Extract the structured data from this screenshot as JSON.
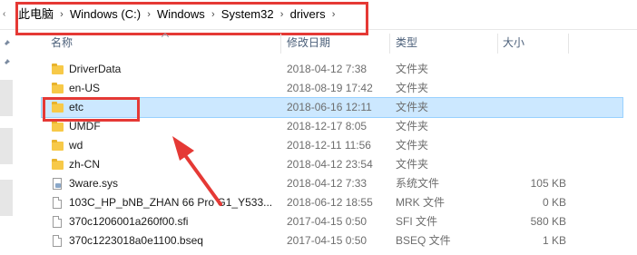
{
  "breadcrumb": {
    "items": [
      "此电脑",
      "Windows (C:)",
      "Windows",
      "System32",
      "drivers"
    ]
  },
  "columns": {
    "name": "名称",
    "date": "修改日期",
    "type": "类型",
    "size": "大小"
  },
  "files": [
    {
      "name": "DriverData",
      "date": "2018-04-12 7:38",
      "type": "文件夹",
      "size": "",
      "icon": "folder-icon"
    },
    {
      "name": "en-US",
      "date": "2018-08-19 17:42",
      "type": "文件夹",
      "size": "",
      "icon": "folder-icon"
    },
    {
      "name": "etc",
      "date": "2018-06-16 12:11",
      "type": "文件夹",
      "size": "",
      "icon": "folder-icon",
      "selected": true
    },
    {
      "name": "UMDF",
      "date": "2018-12-17 8:05",
      "type": "文件夹",
      "size": "",
      "icon": "folder-icon"
    },
    {
      "name": "wd",
      "date": "2018-12-11 11:56",
      "type": "文件夹",
      "size": "",
      "icon": "folder-icon"
    },
    {
      "name": "zh-CN",
      "date": "2018-04-12 23:54",
      "type": "文件夹",
      "size": "",
      "icon": "folder-icon"
    },
    {
      "name": "3ware.sys",
      "date": "2018-04-12 7:33",
      "type": "系统文件",
      "size": "105 KB",
      "icon": "system-file-icon"
    },
    {
      "name": "103C_HP_bNB_ZHAN 66 Pro G1_Y533...",
      "date": "2018-06-12 18:55",
      "type": "MRK 文件",
      "size": "0 KB",
      "icon": "file-icon"
    },
    {
      "name": "370c1206001a260f00.sfi",
      "date": "2017-04-15 0:50",
      "type": "SFI 文件",
      "size": "580 KB",
      "icon": "file-icon"
    },
    {
      "name": "370c1223018a0e1100.bseq",
      "date": "2017-04-15 0:50",
      "type": "BSEQ 文件",
      "size": "1 KB",
      "icon": "file-icon"
    }
  ],
  "colors": {
    "annotation_red": "#e53935",
    "selection_bg": "#cce8ff",
    "folder_yellow": "#f7c948"
  }
}
